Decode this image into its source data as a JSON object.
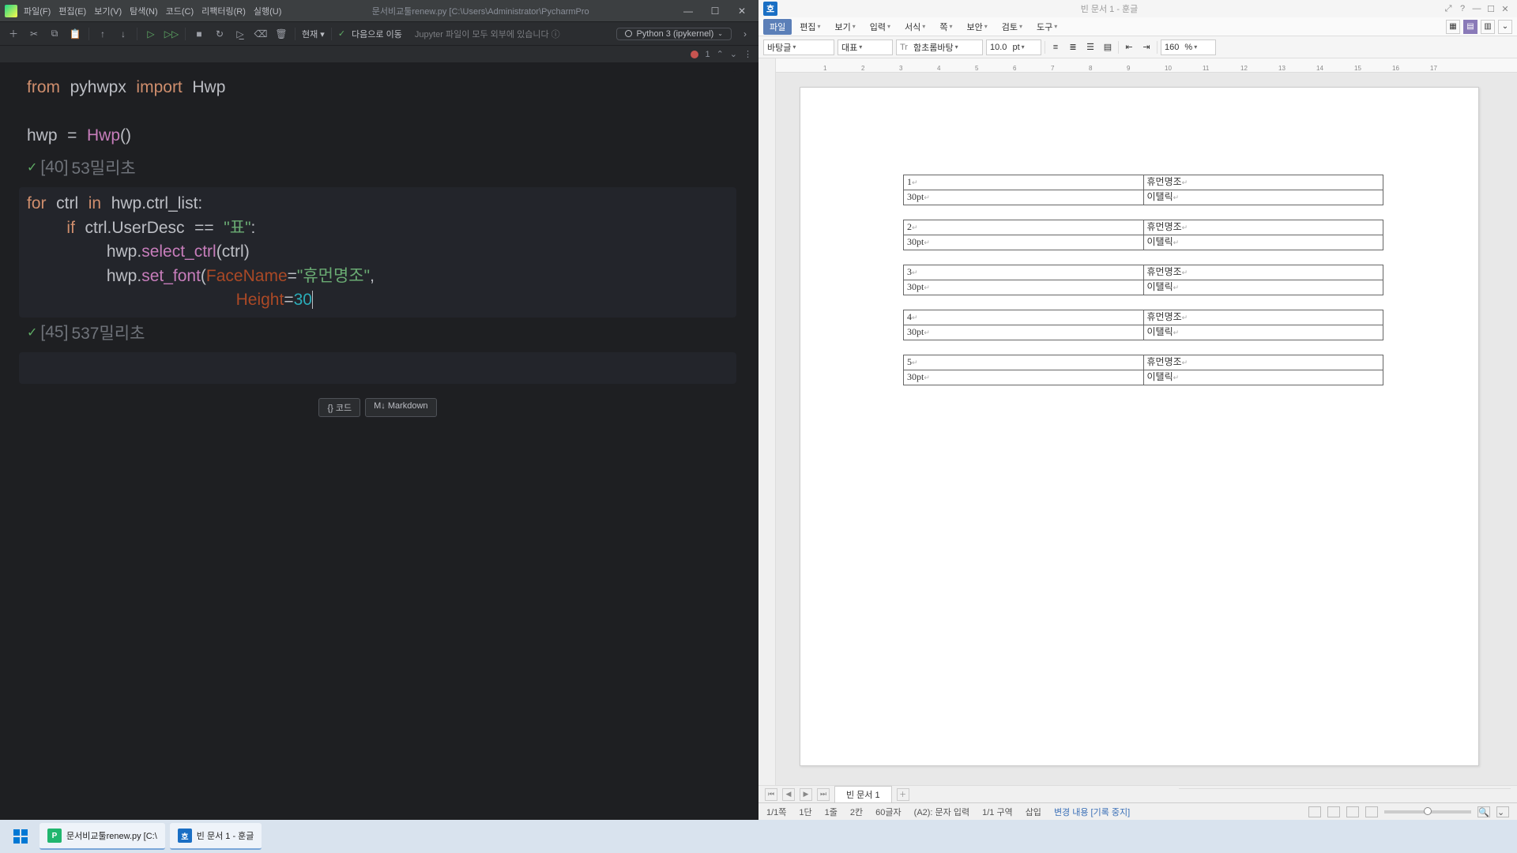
{
  "pycharm": {
    "menus": [
      "파일(F)",
      "편집(E)",
      "보기(V)",
      "탐색(N)",
      "코드(C)",
      "리팩터링(R)",
      "실행(U)"
    ],
    "title": "문서비교툴renew.py [C:\\Users\\Administrator\\PycharmPro",
    "toolbar": {
      "run_dropdown": "현재 ▾",
      "next_check": "✓",
      "next_label": "다음으로 이동",
      "jupyter_warn": "Jupyter 파일이 모두 외부에 있습니다 ⓘ",
      "kernel": "Python 3 (ipykernel)"
    },
    "errorbar": {
      "count": "1",
      "up": "⌃",
      "down": "⌄",
      "menu": "⋮"
    },
    "cells": [
      {
        "code_tokens": [
          {
            "html": "<span class='tok-kw'>from</span> <span class='tok-id'>pyhwpx</span> <span class='tok-kw'>import</span> <span class='tok-id'>Hwp</span>\n\n<span class='tok-id'>hwp</span> <span class='tok-op'>=</span> <span class='tok-fn'>Hwp</span><span class='tok-op'>()</span>"
          }
        ],
        "out_idx": "[40]",
        "out_time": "53밀리초"
      },
      {
        "active": true,
        "code_tokens": [
          {
            "html": "<span class='tok-kw'>for</span> <span class='tok-id'>ctrl</span> <span class='tok-kw'>in</span> <span class='tok-id'>hwp</span><span class='tok-op'>.</span><span class='tok-id'>ctrl_list</span><span class='tok-op'>:</span>\n    <span class='tok-kw'>if</span> <span class='tok-id'>ctrl</span><span class='tok-op'>.</span><span class='tok-id'>UserDesc</span> <span class='tok-op'>==</span> <span class='tok-str'>\"표\"</span><span class='tok-op'>:</span>\n        <span class='tok-id'>hwp</span><span class='tok-op'>.</span><span class='tok-fn'>select_ctrl</span><span class='tok-op'>(</span><span class='tok-id'>ctrl</span><span class='tok-op'>)</span>\n        <span class='tok-id'>hwp</span><span class='tok-op'>.</span><span class='tok-fn'>set_font</span><span class='tok-op'>(</span><span class='tok-param'>FaceName</span><span class='tok-op'>=</span><span class='tok-str'>\"휴먼명조\"</span><span class='tok-op'>,</span>\n                     <span class='tok-param'>Height</span><span class='tok-op'>=</span><span class='tok-num caret'>30</span>"
          }
        ],
        "out_idx": "[45]",
        "out_time": "537밀리초"
      }
    ],
    "addcell": {
      "code": "{} 코드",
      "md": "M↓ Markdown"
    }
  },
  "hangul": {
    "title": "빈 문서 1 - 훈글",
    "menus": [
      "파일",
      "편집",
      "보기",
      "입력",
      "서식",
      "쪽",
      "보안",
      "검토",
      "도구"
    ],
    "format": {
      "style": "바탕글",
      "para": "대표",
      "font": "함초롬바탕",
      "size": "10.0",
      "size_unit": "pt",
      "zoom": "160",
      "zoom_unit": "%"
    },
    "ruler_ticks": [
      "1",
      "2",
      "3",
      "4",
      "5",
      "6",
      "7",
      "8",
      "9",
      "10",
      "11",
      "12",
      "13",
      "14",
      "15",
      "16",
      "17"
    ],
    "tables": [
      {
        "r1c1": "1",
        "r1c2": "휴먼명조",
        "r2c1": "30pt",
        "r2c2": "이탤릭"
      },
      {
        "r1c1": "2",
        "r1c2": "휴먼명조",
        "r2c1": "30pt",
        "r2c2": "이탤릭"
      },
      {
        "r1c1": "3",
        "r1c2": "휴먼명조",
        "r2c1": "30pt",
        "r2c2": "이탤릭"
      },
      {
        "r1c1": "4",
        "r1c2": "휴먼명조",
        "r2c1": "30pt",
        "r2c2": "이탤릭"
      },
      {
        "r1c1": "5",
        "r1c2": "휴먼명조",
        "r2c1": "30pt",
        "r2c2": "이탤릭"
      }
    ],
    "tab": "빈 문서 1",
    "status": {
      "page": "1/1쪽",
      "dan": "1단",
      "line": "1줄",
      "col": "2칸",
      "chars": "60글자",
      "mode": "(A2): 문자 입력",
      "section": "1/1 구역",
      "insert": "삽입",
      "track": "변경 내용 [기록 중지]"
    }
  },
  "taskbar": {
    "apps": [
      {
        "icon_bg": "#21b66f",
        "icon_txt": "P",
        "label": "문서비교툴renew.py [C:\\"
      },
      {
        "icon_bg": "#1a6fc4",
        "icon_txt": "호",
        "label": "빈 문서 1 - 훈글"
      }
    ]
  }
}
